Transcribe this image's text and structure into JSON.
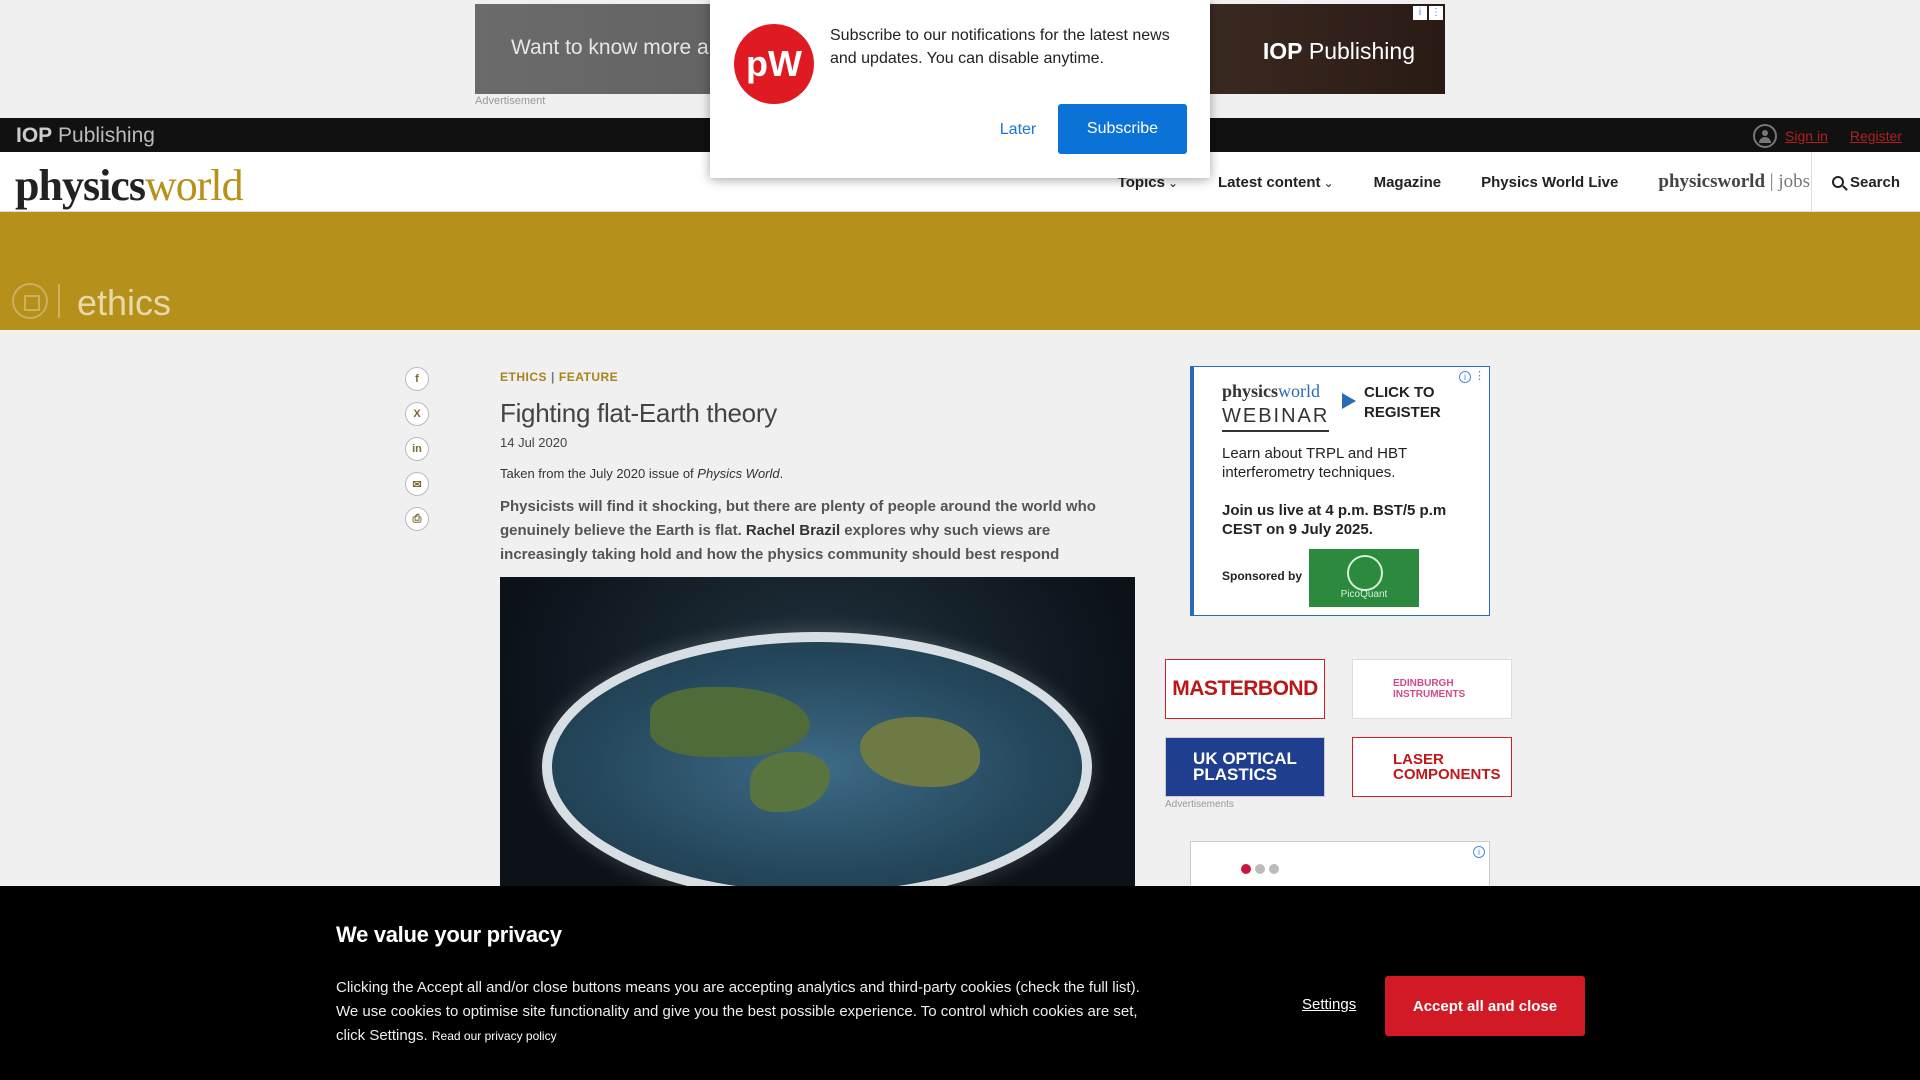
{
  "top_ad": {
    "tease": "Want to know more ab",
    "brand_bold": "IOP",
    "brand_rest": " Publishing",
    "caption": "Advertisement"
  },
  "iop_bar": {
    "logo_bold": "IOP",
    "logo_rest": " Publishing",
    "sign_in": "Sign in",
    "register": "Register"
  },
  "nav": {
    "logo_part1": "physics",
    "logo_part2": "world",
    "topics": "Topics",
    "latest": "Latest content",
    "magazine": "Magazine",
    "live": "Physics World Live",
    "jobs_bold": "physicsworld",
    "jobs_rest": " | jobs",
    "search": "Search"
  },
  "topic": {
    "title": "ethics"
  },
  "share": {
    "facebook": "f",
    "x": "X",
    "linkedin": "in",
    "email": "✉",
    "print": "⎙"
  },
  "article": {
    "crumb1": "ETHICS",
    "crumb_sep": "|",
    "crumb2": "FEATURE",
    "title": "Fighting flat-Earth theory",
    "date": "14 Jul 2020",
    "source_prefix": "Taken from the July 2020 issue of ",
    "source_mag": "Physics World",
    "source_suffix": ".",
    "lede_part1": "Physicists will find it shocking, but there are plenty of people around the world who genuinely believe the Earth is flat. ",
    "lede_author": "Rachel Brazil",
    "lede_part2": " explores why such views are increasingly taking hold and how the physics community should best respond"
  },
  "webinar_ad": {
    "logo_part1": "physics",
    "logo_part2": "world",
    "word": "WEBINAR",
    "cta_line1": "CLICK TO",
    "cta_line2": "REGISTER",
    "desc": "Learn about TRPL and HBT interferometry techniques.",
    "date": "Join us live at 4 p.m. BST/5 p.m CEST on 9 July 2025.",
    "sponsored": "Sponsored by",
    "sponsor": "PicoQuant"
  },
  "small_ads": {
    "masterbond": "MASTERBOND",
    "edinburgh_line1": "EDINBURGH",
    "edinburgh_line2": "INSTRUMENTS",
    "ukoptical_line1": "UK OPTICAL",
    "ukoptical_line2": "PLASTICS",
    "laser_line1": "LASER",
    "laser_line2": "COMPONENTS",
    "caption": "Advertisements"
  },
  "notification": {
    "logo": "pW",
    "text": "Subscribe to our notifications for the latest news and updates. You can disable anytime.",
    "later": "Later",
    "subscribe": "Subscribe"
  },
  "cookie": {
    "title": "We value your privacy",
    "text": "Clicking the Accept all and/or close buttons means you are accepting analytics and third-party cookies (check the full list). We use cookies to optimise site functionality and give you the best possible experience. To control which cookies are set, click Settings. ",
    "link": "Read our privacy policy",
    "settings": "Settings",
    "accept": "Accept all and close"
  },
  "colors": {
    "banner_gold": "#b5901a",
    "accept_red": "#d11a26",
    "subscribe_blue": "#0b73d8",
    "brand_red": "#e01a22"
  }
}
